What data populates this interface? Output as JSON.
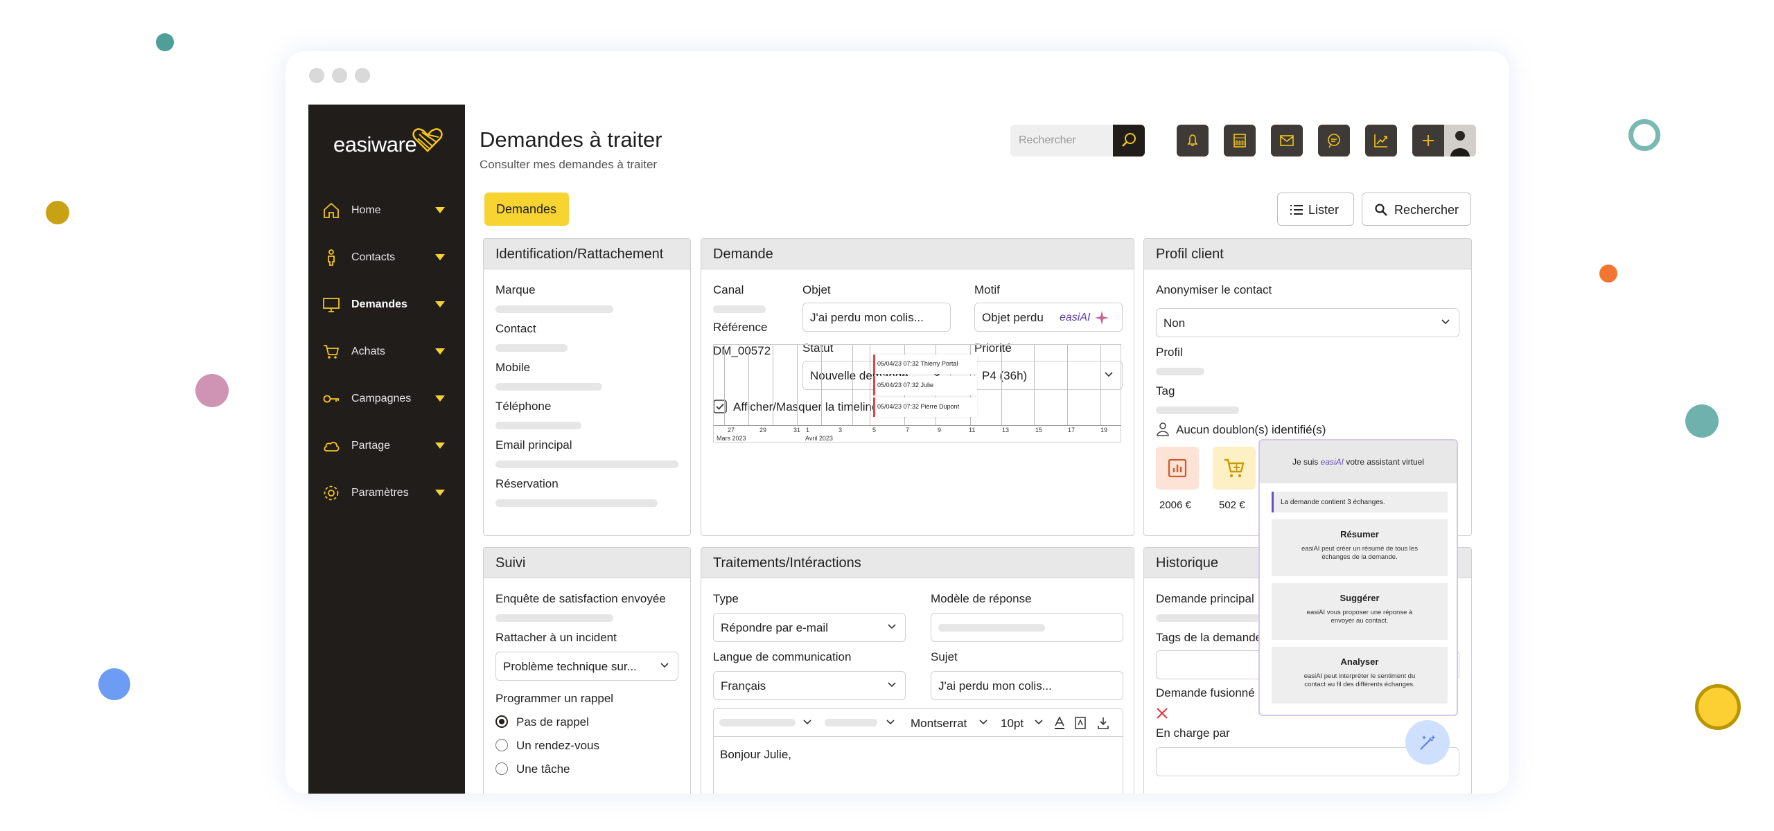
{
  "app": {
    "logo_text": "easiware",
    "page_title": "Demandes à traiter",
    "page_subtitle": "Consulter mes demandes à traiter",
    "accent_color": "#f8d433",
    "sidebar_color": "#201d1a"
  },
  "sidebar": {
    "items": [
      {
        "label": "Home",
        "icon": "home-icon"
      },
      {
        "label": "Contacts",
        "icon": "person-icon"
      },
      {
        "label": "Demandes",
        "icon": "monitor-icon"
      },
      {
        "label": "Achats",
        "icon": "cart-icon"
      },
      {
        "label": "Campagnes",
        "icon": "key-icon"
      },
      {
        "label": "Partage",
        "icon": "cloud-icon"
      },
      {
        "label": "Paramètres",
        "icon": "gear-icon"
      }
    ],
    "active": "Demandes"
  },
  "header": {
    "search_placeholder": "Rechercher",
    "toolbar_icons": [
      "bell-icon",
      "calculator-icon",
      "mail-icon",
      "chat-icon",
      "chart-icon",
      "plus-icon"
    ],
    "chip": "Demandes",
    "lister": "Lister",
    "rechercher": "Rechercher"
  },
  "identification": {
    "title": "Identification/Rattachement",
    "fields": [
      "Marque",
      "Contact",
      "Mobile",
      "Téléphone",
      "Email principal",
      "Réservation"
    ]
  },
  "demande": {
    "title": "Demande",
    "canal_label": "Canal",
    "reference_label": "Référence",
    "reference_value": "DM_00572",
    "objet_label": "Objet",
    "objet_value": "J'ai perdu mon colis...",
    "motif_label": "Motif",
    "motif_value": "Objet perdu",
    "motif_ai_tag": "easiAI",
    "statut_label": "Statut",
    "statut_value": "Nouvelle demande",
    "priorite_label": "Priorité",
    "priorite_value": "P4 (36h)",
    "timeline_toggle": "Afficher/Masquer la timeline",
    "timeline": {
      "ticks": [
        "27",
        "29",
        "31",
        "1",
        "3",
        "5",
        "7",
        "9",
        "11",
        "13",
        "15",
        "17",
        "19"
      ],
      "months": [
        "Mars 2023",
        "Avril 2023"
      ],
      "events": [
        "05/04/23 07:32 Thierry Portal",
        "05/04/23 07:32 Julie",
        "05/04/23 07:32 Pierre Dupont"
      ]
    }
  },
  "profil": {
    "title": "Profil client",
    "anonymiser_label": "Anonymiser le contact",
    "anonymiser_value": "Non",
    "profil_label": "Profil",
    "tag_label": "Tag",
    "doublons": "Aucun doublon(s) identifié(s)",
    "stats": [
      {
        "value": "2006 €",
        "icon": "report-icon"
      },
      {
        "value": "502 €",
        "icon": "cart-icon"
      }
    ]
  },
  "suivi": {
    "title": "Suivi",
    "enquete_label": "Enquête de satisfaction envoyée",
    "incident_label": "Rattacher à un incident",
    "incident_value": "Problème technique sur...",
    "rappel_label": "Programmer un rappel",
    "rappel_options": [
      "Pas de rappel",
      "Un rendez-vous",
      "Une tâche"
    ],
    "rappel_selected": 0
  },
  "traitements": {
    "title": "Traitements/Intéractions",
    "type_label": "Type",
    "type_value": "Répondre par e-mail",
    "modele_label": "Modèle de réponse",
    "langue_label": "Langue de communication",
    "langue_value": "Français",
    "sujet_label": "Sujet",
    "sujet_value": "J'ai perdu mon colis...",
    "font_name": "Montserrat",
    "font_size": "10pt",
    "body_text": "Bonjour Julie,"
  },
  "historique": {
    "title": "Historique",
    "fields": [
      "Demande principal",
      "Tags de la demande",
      "Demande fusionné",
      "En charge par"
    ]
  },
  "ai_assistant": {
    "title_prefix": "Je suis ",
    "title_brand": "easiAI",
    "title_suffix": " votre assistant virtuel",
    "info": "La demande contient 3 échanges.",
    "cards": [
      {
        "title": "Résumer",
        "desc": "easiAI peut créer un résumé de tous les échanges de la demande."
      },
      {
        "title": "Suggérer",
        "desc": "easiAI vous proposer une réponse à envoyer au contact."
      },
      {
        "title": "Analyser",
        "desc": "easiAI peut interpréter le sentiment du contact au fil des différents échanges."
      }
    ]
  }
}
